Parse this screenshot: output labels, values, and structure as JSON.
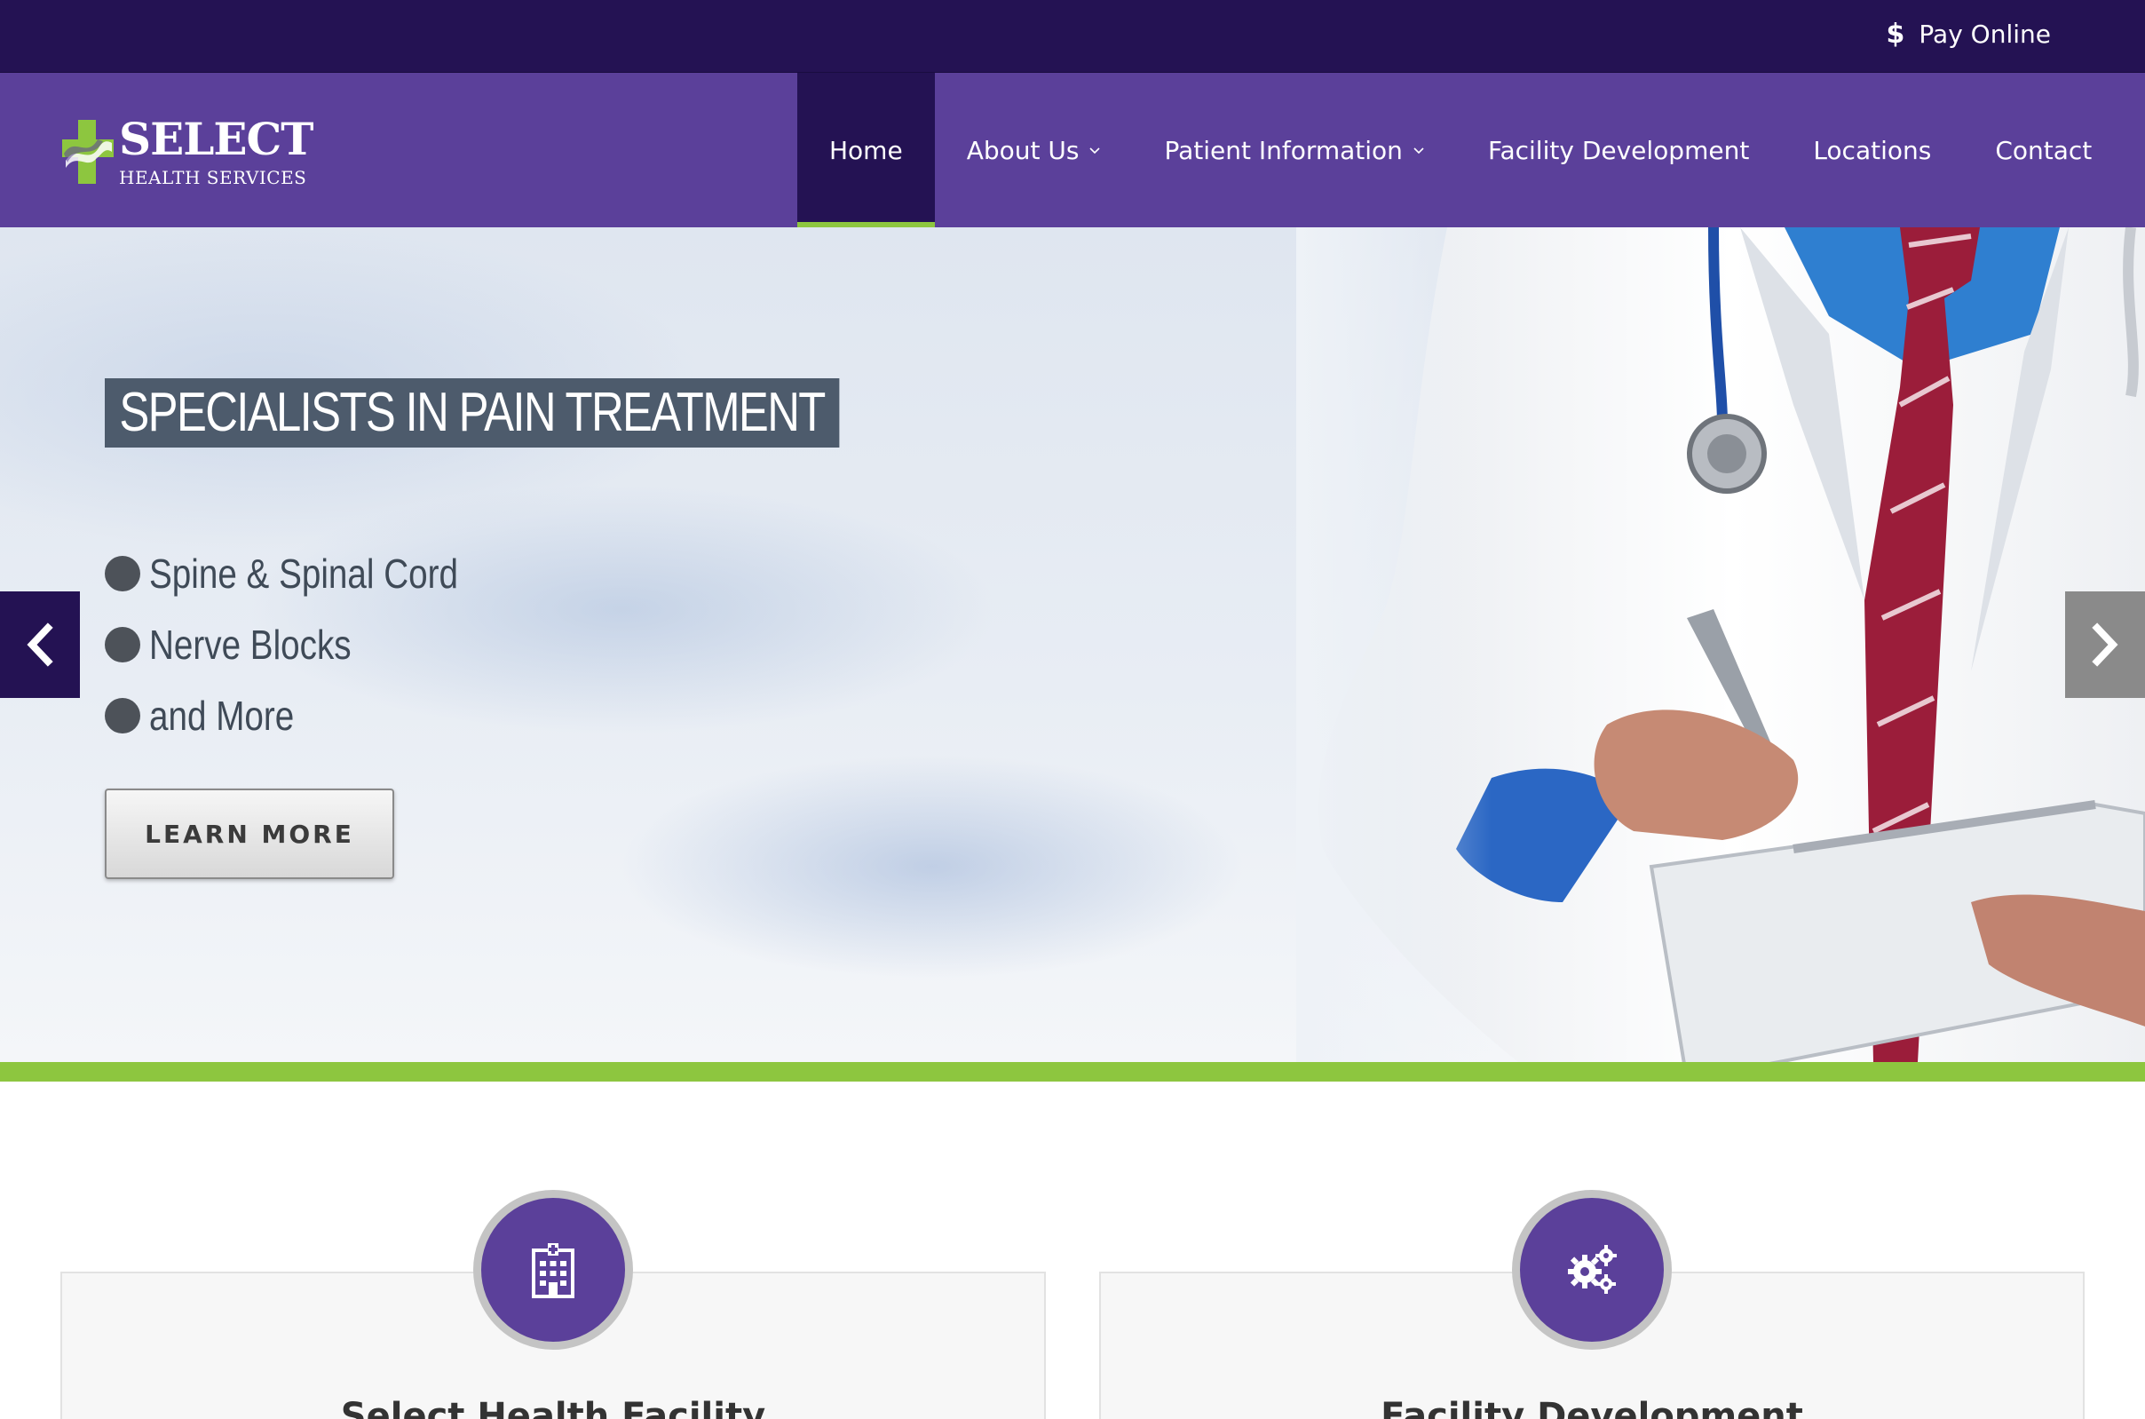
{
  "topbar": {
    "pay_icon": "dollar-sign-icon",
    "pay_label": "Pay Online"
  },
  "logo": {
    "name": "SELECT",
    "tagline": "HEALTH SERVICES"
  },
  "nav": {
    "items": [
      {
        "label": "Home",
        "active": true
      },
      {
        "label": "About Us",
        "has_dropdown": true
      },
      {
        "label": "Patient Information",
        "has_dropdown": true
      },
      {
        "label": "Facility Development"
      },
      {
        "label": "Locations"
      },
      {
        "label": "Contact"
      }
    ]
  },
  "hero": {
    "title": "SPECIALISTS IN PAIN TREATMENT",
    "bullets": [
      "Spine & Spinal Cord",
      "Nerve Blocks",
      "and More"
    ],
    "cta_label": "LEARN MORE",
    "prev_icon": "chevron-left-icon",
    "next_icon": "chevron-right-icon"
  },
  "cards": [
    {
      "icon": "hospital-building-icon",
      "title": "Select Health Facility"
    },
    {
      "icon": "gears-icon",
      "title": "Facility Development"
    }
  ],
  "colors": {
    "topbar": "#241253",
    "nav": "#5b409a",
    "accent_green": "#8dc63f",
    "title_box": "#4d5b6c"
  }
}
